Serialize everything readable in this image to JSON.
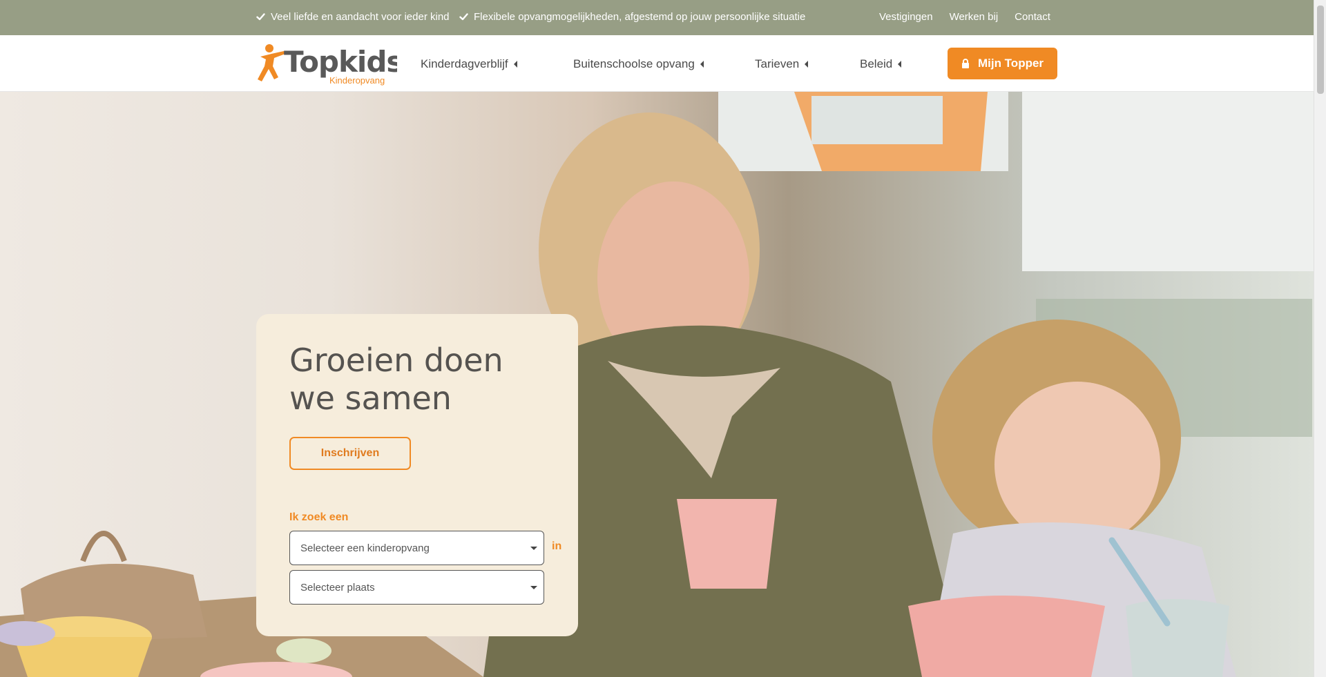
{
  "topbar": {
    "usp1": "Veel liefde en aandacht voor ieder kind",
    "usp2": "Flexibele opvangmogelijkheden, afgestemd op jouw persoonlijke situatie",
    "links": [
      "Vestigingen",
      "Werken bij",
      "Contact"
    ]
  },
  "header": {
    "logo_text": "Topkids",
    "logo_sub": "Kinderopvang",
    "nav": [
      "Kinderdagverblijf",
      "Buitenschoolse opvang",
      "Tarieven",
      "Beleid"
    ],
    "cta_label": "Mijn Topper"
  },
  "hero": {
    "title": "Groeien doen we samen",
    "signup_label": "Inschrijven",
    "search_label": "Ik zoek een",
    "select_type_placeholder": "Selecteer een kinderopvang",
    "in_label": "in",
    "select_place_placeholder": "Selecteer plaats"
  },
  "colors": {
    "topbar": "#979e85",
    "accent": "#f08a24",
    "card": "#f6eddc",
    "text": "#4a4a4a"
  },
  "icons": [
    "check-icon",
    "lock-icon",
    "caret-left-icon",
    "select-arrow-icon"
  ]
}
